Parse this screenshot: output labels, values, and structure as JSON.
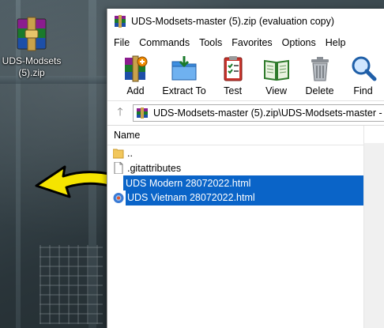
{
  "desktop": {
    "icon_label_line1": "UDS-Modsets",
    "icon_label_line2": "(5).zip"
  },
  "window": {
    "title": "UDS-Modsets-master (5).zip (evaluation copy)"
  },
  "menu": [
    "File",
    "Commands",
    "Tools",
    "Favorites",
    "Options",
    "Help"
  ],
  "toolbar": [
    {
      "label": "Add",
      "icon": "add-archive-icon"
    },
    {
      "label": "Extract To",
      "icon": "extract-folder-icon"
    },
    {
      "label": "Test",
      "icon": "test-clipboard-icon"
    },
    {
      "label": "View",
      "icon": "view-book-icon"
    },
    {
      "label": "Delete",
      "icon": "trash-icon"
    },
    {
      "label": "Find",
      "icon": "magnifier-icon"
    }
  ],
  "address": {
    "path": "UDS-Modsets-master (5).zip\\UDS-Modsets-master -"
  },
  "columns": {
    "name": "Name"
  },
  "files": [
    {
      "name": "..",
      "icon": "folder-icon",
      "selected": false
    },
    {
      "name": ".gitattributes",
      "icon": "file-icon",
      "selected": false
    },
    {
      "name": "UDS Modern 28072022.html",
      "icon": "none",
      "selected": true
    },
    {
      "name": "UDS Vietnam 28072022.html",
      "icon": "html-globe-icon",
      "selected": true
    }
  ],
  "colors": {
    "selection": "#0a64c8",
    "arrow_fill": "#f5e400"
  }
}
